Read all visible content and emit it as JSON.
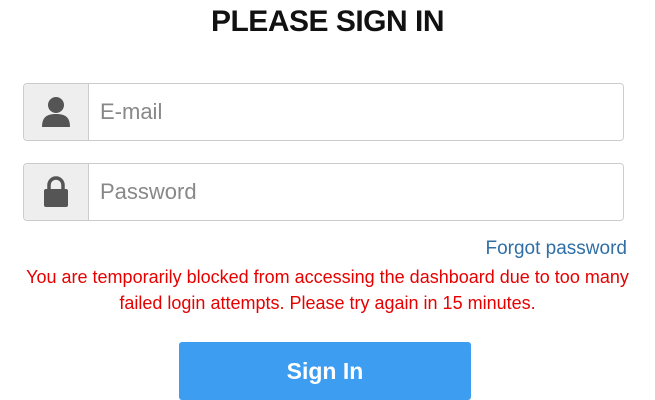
{
  "title": "PLEASE SIGN IN",
  "email": {
    "placeholder": "E-mail",
    "value": "",
    "icon": "user-icon"
  },
  "password": {
    "placeholder": "Password",
    "value": "",
    "icon": "lock-icon"
  },
  "forgot_link": "Forgot password",
  "error": {
    "line1": "You are temporarily blocked from accessing the dashboard due to too many",
    "line2": "failed login attempts. Please try again in 15 minutes."
  },
  "submit_label": "Sign In",
  "colors": {
    "accent": "#3d9df1",
    "link": "#2f6fa5",
    "error": "#e60000",
    "addon_bg": "#eeeeee",
    "icon": "#555555"
  }
}
